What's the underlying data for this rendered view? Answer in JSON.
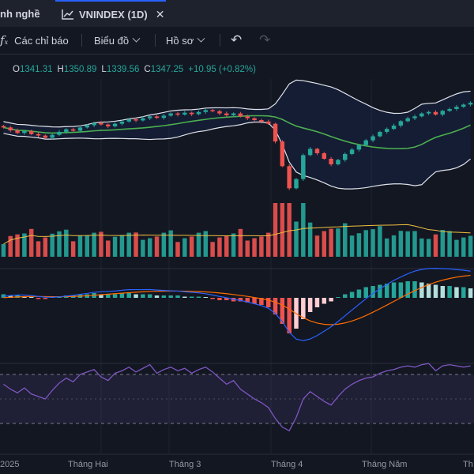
{
  "tabs": {
    "prev_label": "nh nghề",
    "active_label": "VNINDEX (1D)",
    "close_glyph": "✕"
  },
  "toolbar": {
    "indicators_label": "Các chỉ báo",
    "chart_type_label": "Biểu đồ",
    "profile_label": "Hồ sơ",
    "undo_glyph": "↶",
    "redo_glyph": "↷"
  },
  "ohlc": {
    "o_label": "O",
    "o_value": "1341.31",
    "h_label": "H",
    "h_value": "1350.89",
    "l_label": "L",
    "l_value": "1339.56",
    "c_label": "C",
    "c_value": "1347.25",
    "change": "+10.95 (+0.82%)"
  },
  "x_axis": {
    "labels": [
      "2025",
      "Tháng Hai",
      "Tháng 3",
      "Tháng 4",
      "Tháng Năm",
      "Th"
    ]
  },
  "colors": {
    "up": "#26a69a",
    "down": "#ef5350",
    "bb_band": "#e0e3eb",
    "bb_mid": "#4caf50",
    "macd_line": "#2962ff",
    "signal_line": "#ff6d00",
    "rsi_line": "#7e57c2",
    "volume_ma": "#f0c040",
    "background": "#131722"
  },
  "chart_data": {
    "type": "candlestick",
    "candles": [
      1280,
      1272,
      1265,
      1270,
      1262,
      1258,
      1252,
      1260,
      1268,
      1275,
      1271,
      1280,
      1286,
      1292,
      1288,
      1283,
      1290,
      1296,
      1302,
      1299,
      1305,
      1310,
      1306,
      1312,
      1318,
      1315,
      1320,
      1316,
      1322,
      1327,
      1324,
      1318,
      1313,
      1318,
      1310,
      1305,
      1300,
      1296,
      1290,
      1242,
      1175,
      1115,
      1140,
      1205,
      1222,
      1210,
      1195,
      1180,
      1192,
      1208,
      1220,
      1232,
      1245,
      1256,
      1268,
      1276,
      1285,
      1297,
      1305,
      1310,
      1318,
      1322,
      1315,
      1325,
      1330,
      1336,
      1342,
      1347
    ],
    "macd_hist": [
      3,
      2,
      2,
      1,
      0,
      -1,
      -1,
      0,
      1,
      2,
      2,
      3,
      3,
      4,
      3,
      3,
      3,
      4,
      4,
      3,
      3,
      3,
      2,
      2,
      2,
      2,
      1,
      1,
      1,
      0,
      -1,
      -2,
      -2,
      -3,
      -3,
      -4,
      -5,
      -6,
      -8,
      -14,
      -22,
      -30,
      -26,
      -18,
      -12,
      -8,
      -5,
      -3,
      0,
      3,
      5,
      7,
      9,
      10,
      11,
      12,
      13,
      13,
      14,
      14,
      13,
      12,
      11,
      10,
      10,
      9,
      9,
      8
    ],
    "rsi": [
      52,
      48,
      45,
      49,
      44,
      42,
      40,
      47,
      53,
      57,
      54,
      60,
      62,
      64,
      58,
      55,
      61,
      63,
      66,
      62,
      65,
      68,
      61,
      64,
      66,
      63,
      65,
      61,
      64,
      66,
      62,
      57,
      52,
      55,
      48,
      44,
      40,
      37,
      33,
      24,
      17,
      14,
      25,
      40,
      46,
      42,
      38,
      35,
      42,
      48,
      52,
      55,
      57,
      58,
      61,
      63,
      64,
      66,
      67,
      66,
      68,
      69,
      63,
      67,
      68,
      67,
      66,
      67
    ]
  }
}
